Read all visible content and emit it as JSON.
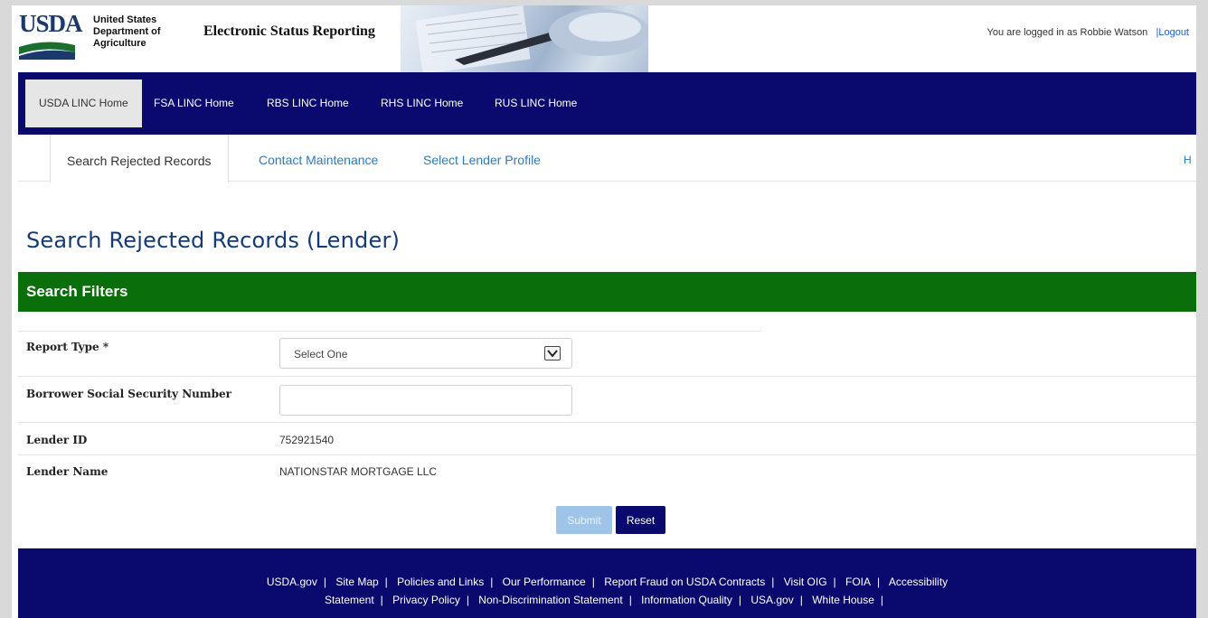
{
  "header": {
    "logo_text": "USDA",
    "agency_line1": "United States",
    "agency_line2": "Department of",
    "agency_line3": "Agriculture",
    "site_title": "Electronic Status Reporting",
    "user_text": "You are logged in as Robbie Watson",
    "logout_label": "|Logout"
  },
  "nav": {
    "items": [
      {
        "label": "USDA LINC Home"
      },
      {
        "label": "FSA LINC Home"
      },
      {
        "label": "RBS LINC Home"
      },
      {
        "label": "RHS LINC Home"
      },
      {
        "label": "RUS LINC Home"
      }
    ]
  },
  "tabs": {
    "items": [
      {
        "label": "Search Rejected Records"
      },
      {
        "label": "Contact Maintenance"
      },
      {
        "label": "Select Lender Profile"
      },
      {
        "label": "H"
      }
    ]
  },
  "main": {
    "page_title": "Search Rejected Records (Lender)",
    "filters_title": "Search Filters"
  },
  "form": {
    "report_type_label": "Report Type *",
    "report_type_value": "Select One",
    "ssn_label": "Borrower Social Security Number",
    "ssn_value": "",
    "lender_id_label": "Lender ID",
    "lender_id_value": "752921540",
    "lender_name_label": "Lender Name",
    "lender_name_value": "NATIONSTAR MORTGAGE LLC",
    "submit_label": "Submit",
    "reset_label": "Reset"
  },
  "footer": {
    "row1": [
      "USDA.gov",
      "Site Map",
      "Policies and Links",
      "Our Performance",
      "Report Fraud on USDA Contracts",
      "Visit OIG",
      "FOIA",
      "Accessibility"
    ],
    "row2": [
      "Statement",
      "Privacy Policy",
      "Non-Discrimination Statement",
      "Information Quality",
      "USA.gov",
      "White House"
    ]
  },
  "colors": {
    "nav_bg": "#0a0a6e",
    "filters_bg": "#0a6e0a",
    "title_color": "#153a78",
    "link_color": "#2b7bc4"
  }
}
